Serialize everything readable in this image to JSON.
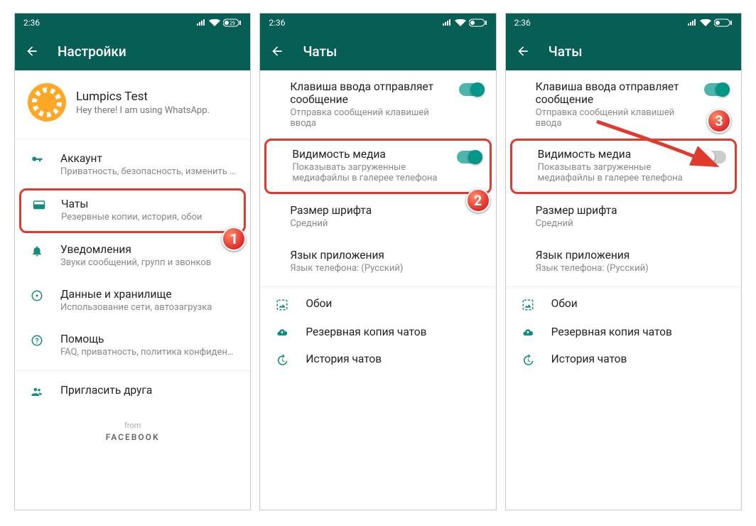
{
  "status": {
    "time": "2:36",
    "battery": "29"
  },
  "screen1": {
    "title": "Настройки",
    "profile_name": "Lumpics Test",
    "profile_status": "Hey there! I am using WhatsApp.",
    "items": {
      "account": {
        "title": "Аккаунт",
        "sub": "Приватность, безопасность, изменить номер"
      },
      "chats": {
        "title": "Чаты",
        "sub": "Резервные копии, история, обои"
      },
      "notif": {
        "title": "Уведомления",
        "sub": "Звуки сообщений, групп и звонков"
      },
      "data": {
        "title": "Данные и хранилище",
        "sub": "Использование сети, автозагрузка"
      },
      "help": {
        "title": "Помощь",
        "sub": "FAQ, приватность, политика конфиденциальн..."
      },
      "invite": {
        "title": "Пригласить друга"
      }
    },
    "footer_from": "from",
    "footer_brand": "FACEBOOK"
  },
  "chats_screen": {
    "title": "Чаты",
    "enter_send": {
      "title": "Клавиша ввода отправляет сообщение",
      "sub": "Отправка сообщений клавишей ввода"
    },
    "media_vis": {
      "title": "Видимость медиа",
      "sub": "Показывать загруженные медиафайлы в галерее телефона"
    },
    "font": {
      "title": "Размер шрифта",
      "sub": "Средний"
    },
    "lang": {
      "title": "Язык приложения",
      "sub": "Язык телефона: (Русский)"
    },
    "wallpaper": "Обои",
    "backup": "Резервная копия чатов",
    "history": "История чатов"
  },
  "badges": {
    "b1": "1",
    "b2": "2",
    "b3": "3"
  }
}
